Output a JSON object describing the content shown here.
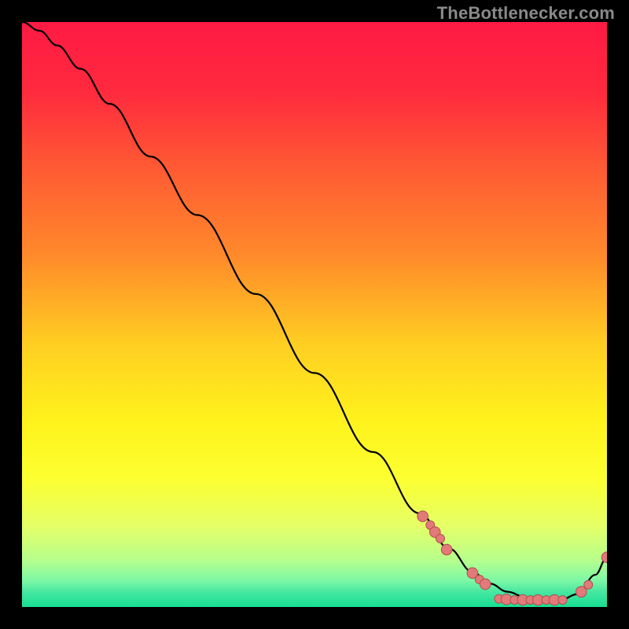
{
  "attribution": "TheBottlenecker.com",
  "chart_data": {
    "type": "line",
    "title": "",
    "xlabel": "",
    "ylabel": "",
    "xlim": [
      0,
      100
    ],
    "ylim": [
      0,
      100
    ],
    "grid": false,
    "gradient_stops": [
      {
        "offset": 0.0,
        "color": "#ff1a44"
      },
      {
        "offset": 0.12,
        "color": "#ff2a3e"
      },
      {
        "offset": 0.25,
        "color": "#ff5a33"
      },
      {
        "offset": 0.4,
        "color": "#ff8a2a"
      },
      {
        "offset": 0.55,
        "color": "#ffce22"
      },
      {
        "offset": 0.68,
        "color": "#fff21c"
      },
      {
        "offset": 0.78,
        "color": "#fcff30"
      },
      {
        "offset": 0.86,
        "color": "#e6ff66"
      },
      {
        "offset": 0.92,
        "color": "#b6ff8c"
      },
      {
        "offset": 0.955,
        "color": "#7cf7a6"
      },
      {
        "offset": 0.975,
        "color": "#44e6a0"
      },
      {
        "offset": 1.0,
        "color": "#17df93"
      }
    ],
    "series": [
      {
        "name": "bottleneck-curve",
        "x": [
          0,
          3,
          6,
          10,
          15,
          22,
          30,
          40,
          50,
          60,
          68,
          73,
          77,
          80,
          83,
          86,
          89,
          92,
          95,
          98,
          100
        ],
        "y": [
          100,
          98.5,
          96,
          92,
          86,
          77,
          67,
          53.5,
          40,
          26.5,
          16,
          10,
          6,
          4,
          2.6,
          1.7,
          1.2,
          1.2,
          2.2,
          5.5,
          8.5
        ]
      }
    ],
    "points": {
      "name": "highlighted-data-points",
      "color": "#e27a7a",
      "stroke": "#b24d4d",
      "radius_small": 5.5,
      "radius_large": 6.8,
      "items": [
        {
          "x": 68.5,
          "y": 15.5,
          "r": "l"
        },
        {
          "x": 69.8,
          "y": 14.0,
          "r": "s"
        },
        {
          "x": 70.6,
          "y": 12.8,
          "r": "l"
        },
        {
          "x": 71.5,
          "y": 11.7,
          "r": "s"
        },
        {
          "x": 72.6,
          "y": 9.8,
          "r": "l"
        },
        {
          "x": 77.0,
          "y": 5.8,
          "r": "l"
        },
        {
          "x": 78.2,
          "y": 4.7,
          "r": "s"
        },
        {
          "x": 79.2,
          "y": 3.9,
          "r": "l"
        },
        {
          "x": 81.5,
          "y": 1.4,
          "r": "s"
        },
        {
          "x": 82.8,
          "y": 1.3,
          "r": "l"
        },
        {
          "x": 84.2,
          "y": 1.2,
          "r": "s"
        },
        {
          "x": 85.6,
          "y": 1.2,
          "r": "l"
        },
        {
          "x": 86.9,
          "y": 1.2,
          "r": "s"
        },
        {
          "x": 88.2,
          "y": 1.2,
          "r": "l"
        },
        {
          "x": 89.6,
          "y": 1.2,
          "r": "s"
        },
        {
          "x": 91.0,
          "y": 1.2,
          "r": "l"
        },
        {
          "x": 92.4,
          "y": 1.2,
          "r": "s"
        },
        {
          "x": 95.6,
          "y": 2.6,
          "r": "l"
        },
        {
          "x": 96.8,
          "y": 3.8,
          "r": "s"
        },
        {
          "x": 100,
          "y": 8.5,
          "r": "l"
        }
      ]
    }
  }
}
